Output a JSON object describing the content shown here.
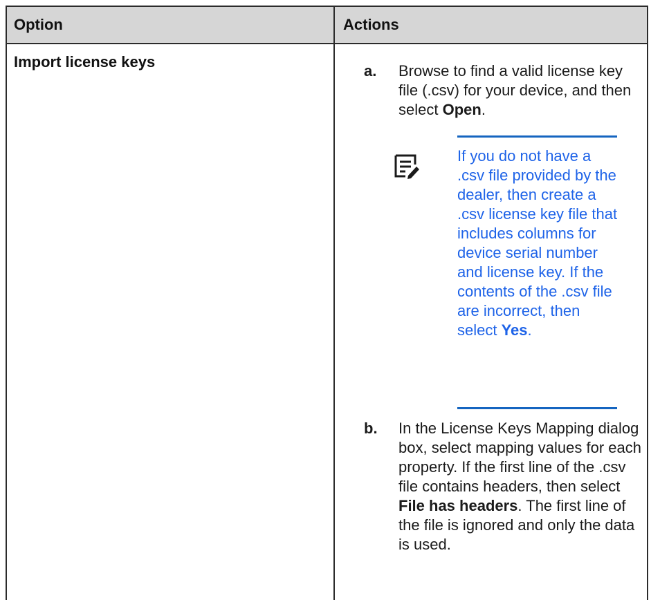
{
  "table": {
    "headers": {
      "option": "Option",
      "actions": "Actions"
    },
    "rows": [
      {
        "option": "Import license keys",
        "steps": [
          {
            "marker": "a.",
            "text_before": "Browse to find a valid license key file (.csv) for your device, and then select ",
            "bold": "Open",
            "text_after": "."
          },
          {
            "marker": "b.",
            "text_before": "In the License Keys Mapping dialog box, select mapping values for each property. If the first line of the .csv file contains headers, then select ",
            "bold": "File has headers",
            "text_after": ". The first line of the file is ignored and only the data is used."
          }
        ],
        "note": {
          "icon": "note-pencil-icon",
          "text_before": "If you do not have a .csv file provided by the dealer, then create a .csv license key file that includes columns for device serial number and license key. If the contents of the .csv file are incorrect, then select ",
          "bold": "Yes",
          "text_after": "."
        }
      }
    ]
  },
  "colors": {
    "header_bg": "#d6d6d6",
    "border": "#2b2b2b",
    "note_text": "#1e63e8",
    "note_rule": "#1565c0"
  }
}
